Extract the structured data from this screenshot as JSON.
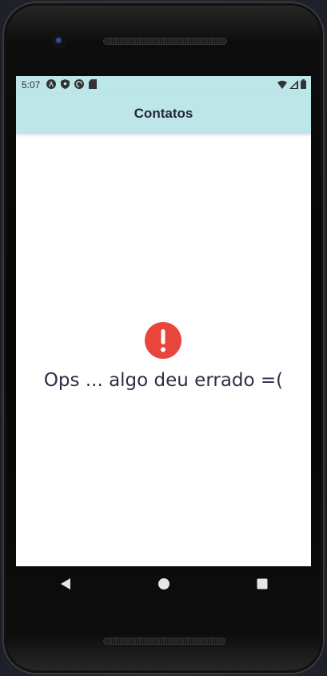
{
  "status_bar": {
    "time": "5:07",
    "left_icons": [
      "android-studio-icon",
      "shield-icon",
      "sync-icon",
      "sd-card-icon"
    ],
    "right_icons": [
      "wifi-icon",
      "cell-signal-icon",
      "battery-icon"
    ]
  },
  "app_bar": {
    "title": "Contatos",
    "background": "#bde6e9"
  },
  "content": {
    "error_icon": "error-exclamation-icon",
    "error_icon_color": "#e8453c",
    "message": "Ops ... algo deu errado =("
  },
  "nav_bar": {
    "buttons": [
      "back-icon",
      "home-icon",
      "recents-icon"
    ]
  }
}
